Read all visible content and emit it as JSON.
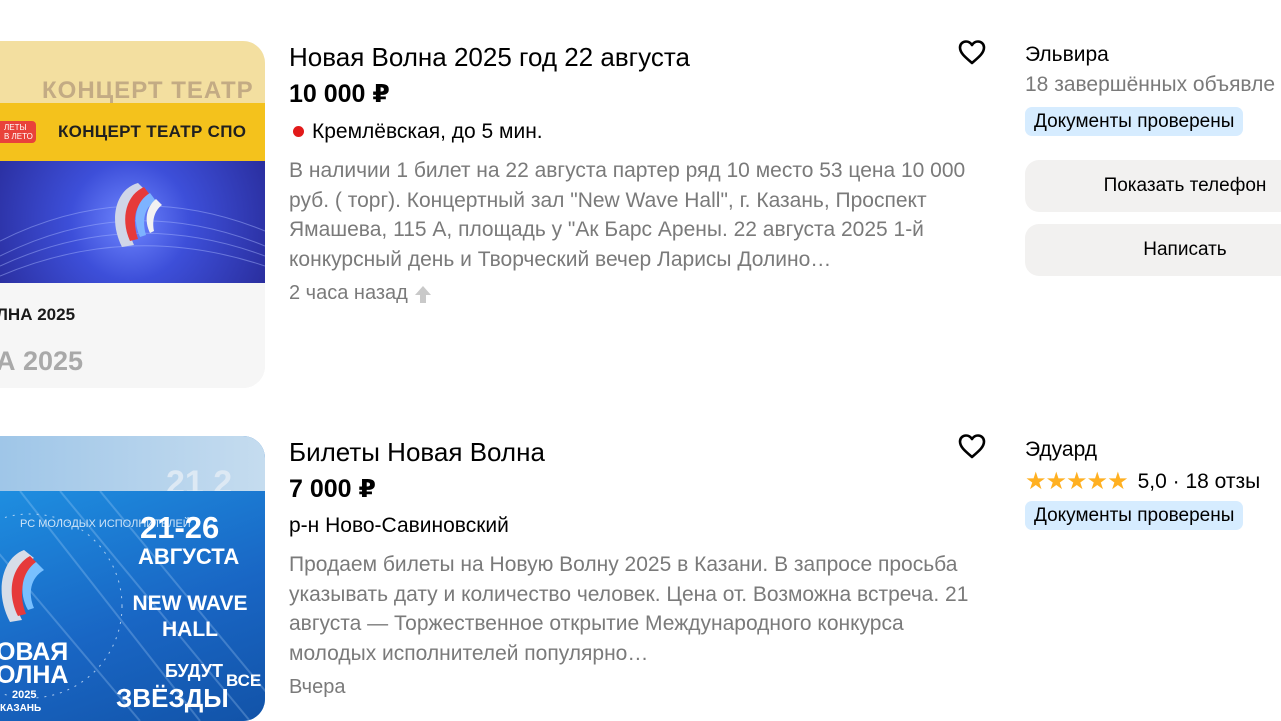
{
  "listings": [
    {
      "title": "Новая Волна 2025 год 22 августа",
      "price": "10 000 ₽",
      "location": "Кремлёвская, до 5 мин.",
      "metro_color": "#e21a1a",
      "description": "В наличии 1 билет на 22 августа партер ряд 10 место 53 цена 10 000 руб. ( торг). Концертный зал \"New Wave Hall\", г. Казань, Проспект Ямашева, 115 А, площадь у \"Ак Барс Арены. 22 августа 2025 1-й конкурсный день и Творческий вечер Ларисы Долино…",
      "time": "2 часа назад",
      "time_icon": "promotion-arrow-icon",
      "image": {
        "menu": "КОНЦЕРТ   ТЕАТР   СПО",
        "ghost_menu": "КОНЦЕРТ   ТЕАТР",
        "badge": "ЛЕТЫ В ЛЕТО",
        "caption1": "ЛНА 2025",
        "caption2": "А 2025"
      },
      "seller": {
        "name": "Эльвира",
        "stats": "18 завершённых объявле",
        "badge": "Документы проверены"
      },
      "buttons": {
        "phone": "Показать телефон",
        "write": "Написать"
      }
    },
    {
      "title": "Билеты Новая Волна",
      "price": "7 000 ₽",
      "location": "р-н Ново-Савиновский",
      "description": "Продаем билеты на Новую Волну 2025 в Казани. В запросе просьба указывать дату и количество человек. Цена от. Возможна встреча. 21 августа — Торжественное открытие Международного конкурса молодых исполнителей популярно…",
      "time": "Вчера",
      "image": {
        "ghost": "21 2",
        "dates": "21-26",
        "month": "АВГУСТА",
        "hall": "NEW WAVE HALL",
        "budut": "БУДУТ",
        "vse": "ВСЕ",
        "zvezdy": "ЗВЁЗДЫ",
        "nova1": "ОВАЯ",
        "nova2": "ОЛНА",
        "year": "2025",
        "city": "КАЗАНЬ",
        "ring": "РС МОЛОДЫХ ИСПОЛНИТЕЛЕЙ"
      },
      "seller": {
        "name": "Эдуард",
        "rating": "5,0",
        "reviews": "· 18 отзы",
        "stars": 5,
        "badge": "Документы проверены"
      }
    }
  ],
  "colors": {
    "badge_bg": "#d6ecff",
    "star": "#ffb021",
    "muted_text": "#7a7a7a",
    "button_bg": "#f2f1f0"
  }
}
